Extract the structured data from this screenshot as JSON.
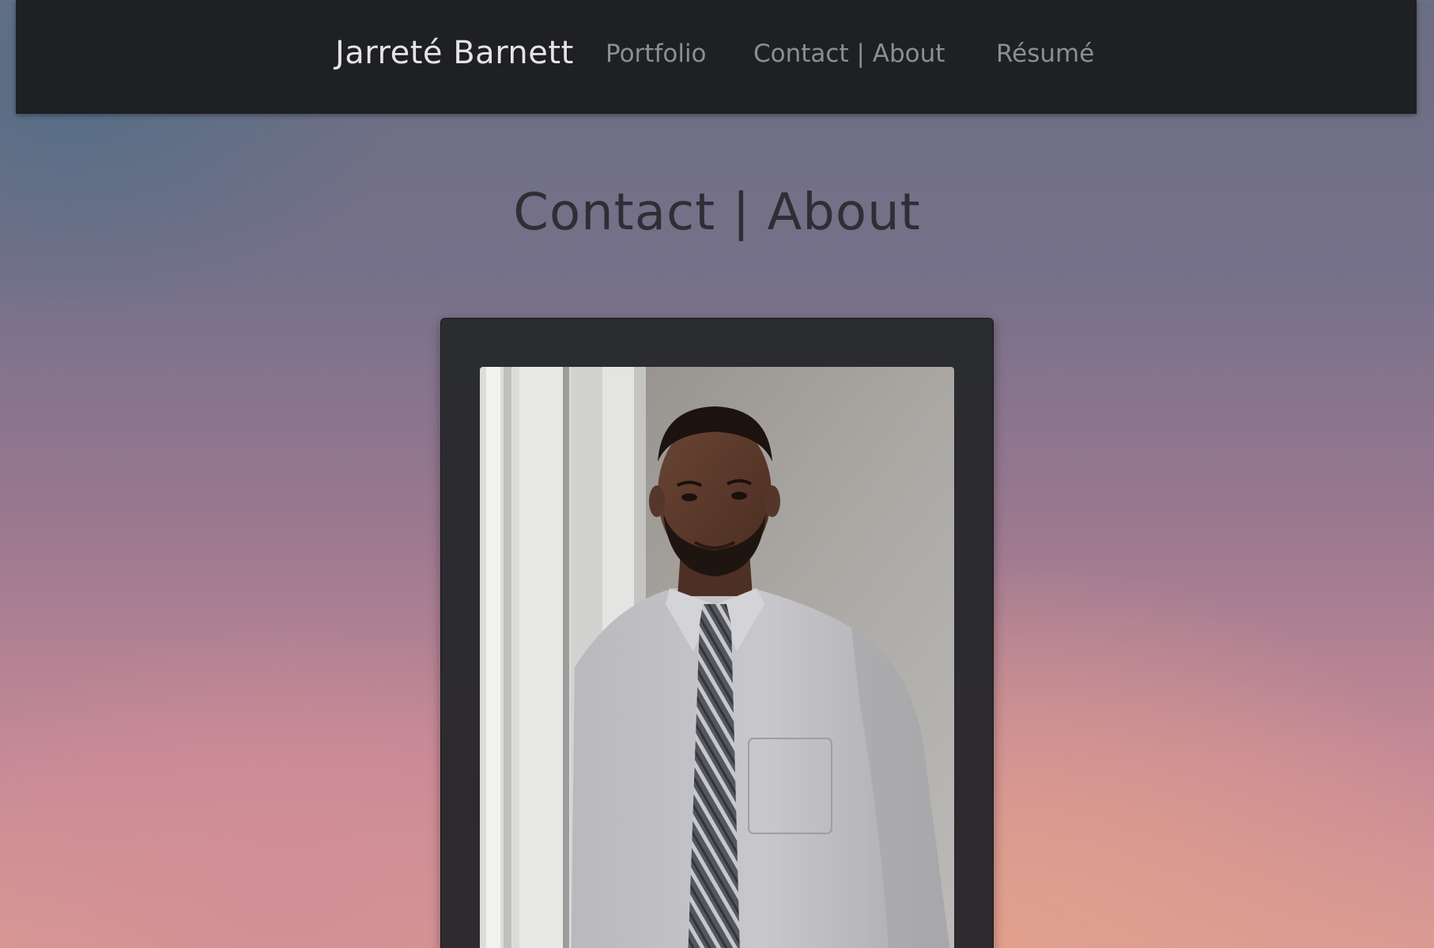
{
  "nav": {
    "brand": "Jarreté Barnett",
    "links": [
      {
        "label": "Portfolio"
      },
      {
        "label": "Contact | About"
      },
      {
        "label": "Résumé"
      }
    ]
  },
  "page": {
    "title": "Contact | About"
  },
  "profile_photo": {
    "icon": "portrait-photo"
  },
  "colors": {
    "navbar_bg": "#1f2023",
    "brand_text": "#e4e4e4",
    "nav_link_text": "#8c8e93",
    "title_text": "#2e2f35",
    "card_bg": "#2b2c30"
  }
}
